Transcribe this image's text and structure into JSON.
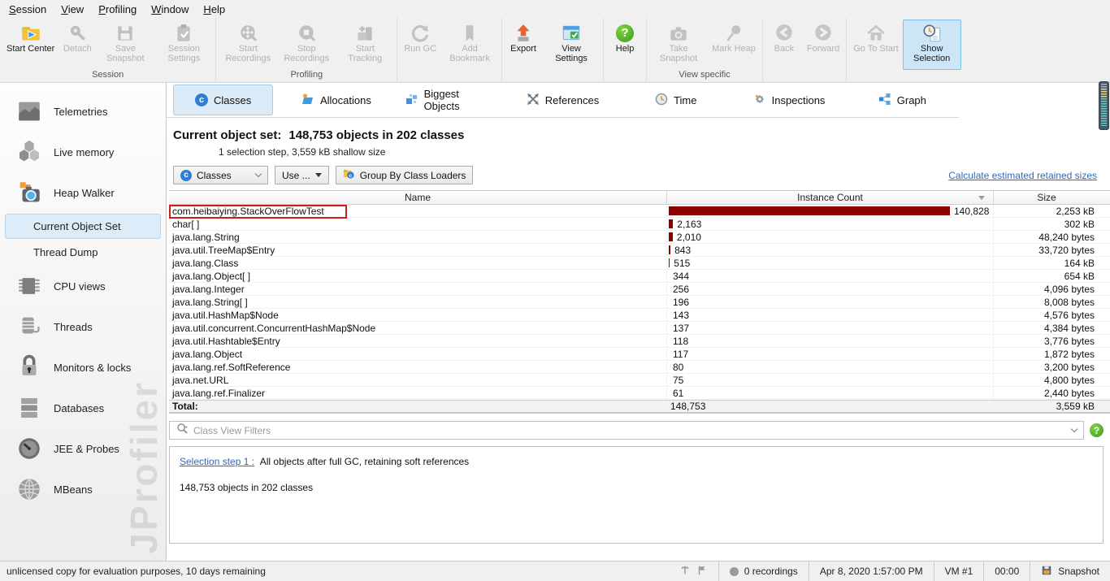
{
  "menu": {
    "items": [
      "Session",
      "View",
      "Profiling",
      "Window",
      "Help"
    ]
  },
  "toolbar": {
    "groups": [
      {
        "label": "Session",
        "buttons": [
          {
            "label": "Start Center"
          },
          {
            "label": "Detach"
          },
          {
            "label": "Save Snapshot"
          },
          {
            "label": "Session Settings"
          }
        ]
      },
      {
        "label": "Profiling",
        "buttons": [
          {
            "label": "Start Recordings"
          },
          {
            "label": "Stop Recordings"
          },
          {
            "label": "Start Tracking"
          }
        ]
      },
      {
        "label": "",
        "buttons": [
          {
            "label": "Run GC"
          },
          {
            "label": "Add Bookmark"
          }
        ]
      },
      {
        "label": "",
        "buttons": [
          {
            "label": "Export"
          },
          {
            "label": "View Settings"
          }
        ]
      },
      {
        "label": "",
        "buttons": [
          {
            "label": "Help"
          }
        ]
      },
      {
        "label": "View specific",
        "buttons": [
          {
            "label": "Take Snapshot"
          },
          {
            "label": "Mark Heap"
          }
        ]
      },
      {
        "label": "",
        "buttons": [
          {
            "label": "Back"
          },
          {
            "label": "Forward"
          }
        ]
      },
      {
        "label": "",
        "buttons": [
          {
            "label": "Go To Start"
          },
          {
            "label": "Show Selection"
          }
        ]
      }
    ]
  },
  "sidebar": {
    "items": [
      {
        "label": "Telemetries"
      },
      {
        "label": "Live memory"
      },
      {
        "label": "Heap Walker"
      },
      {
        "label": "Current Object Set"
      },
      {
        "label": "Thread Dump"
      },
      {
        "label": "CPU views"
      },
      {
        "label": "Threads"
      },
      {
        "label": "Monitors & locks"
      },
      {
        "label": "Databases"
      },
      {
        "label": "JEE & Probes"
      },
      {
        "label": "MBeans"
      }
    ],
    "watermark": "JProfiler"
  },
  "tabs": {
    "items": [
      {
        "label": "Classes"
      },
      {
        "label": "Allocations"
      },
      {
        "label": "Biggest Objects"
      },
      {
        "label": "References"
      },
      {
        "label": "Time"
      },
      {
        "label": "Inspections"
      },
      {
        "label": "Graph"
      }
    ]
  },
  "heap": {
    "title": "Current object set:",
    "title_value": "148,753 objects in 202 classes",
    "subtitle": "1 selection step, 3,559 kB shallow size",
    "classes_dropdown": "Classes",
    "use_button": "Use ...",
    "group_button": "Group By Class Loaders",
    "retained_link": "Calculate estimated retained sizes"
  },
  "table": {
    "columns": [
      "Name",
      "Instance Count",
      "Size"
    ],
    "rows": [
      {
        "name": "com.heibaiying.StackOverFlowTest",
        "count": "140,828",
        "size": "2,253 kB"
      },
      {
        "name": "char[ ]",
        "count": "2,163",
        "size": "302 kB"
      },
      {
        "name": "java.lang.String",
        "count": "2,010",
        "size": "48,240 bytes"
      },
      {
        "name": "java.util.TreeMap$Entry",
        "count": "843",
        "size": "33,720 bytes"
      },
      {
        "name": "java.lang.Class",
        "count": "515",
        "size": "164 kB"
      },
      {
        "name": "java.lang.Object[ ]",
        "count": "344",
        "size": "654 kB"
      },
      {
        "name": "java.lang.Integer",
        "count": "256",
        "size": "4,096 bytes"
      },
      {
        "name": "java.lang.String[ ]",
        "count": "196",
        "size": "8,008 bytes"
      },
      {
        "name": "java.util.HashMap$Node",
        "count": "143",
        "size": "4,576 bytes"
      },
      {
        "name": "java.util.concurrent.ConcurrentHashMap$Node",
        "count": "137",
        "size": "4,384 bytes"
      },
      {
        "name": "java.util.Hashtable$Entry",
        "count": "118",
        "size": "3,776 bytes"
      },
      {
        "name": "java.lang.Object",
        "count": "117",
        "size": "1,872 bytes"
      },
      {
        "name": "java.lang.ref.SoftReference",
        "count": "80",
        "size": "3,200 bytes"
      },
      {
        "name": "java.net.URL",
        "count": "75",
        "size": "4,800 bytes"
      },
      {
        "name": "java.lang.ref.Finalizer",
        "count": "61",
        "size": "2,440 bytes"
      }
    ],
    "total": {
      "name": "Total:",
      "count": "148,753",
      "size": "3,559 kB"
    }
  },
  "filter": {
    "placeholder": "Class View Filters"
  },
  "selection": {
    "link": "Selection step 1 :",
    "text": "All objects after full GC, retaining soft references",
    "summary": "148,753 objects in 202 classes"
  },
  "status": {
    "left": "unlicensed copy for evaluation purposes, 10 days remaining",
    "recordings": "0 recordings",
    "timestamp": "Apr 8, 2020 1:57:00 PM",
    "vm": "VM #1",
    "time": "00:00",
    "snapshot": "Snapshot"
  },
  "colors": {
    "instance_bar": "#8b0000",
    "selection_bg": "#ddecf9",
    "tab_selected_bg": "#dcebf8",
    "link": "#3567b0",
    "annotation_border": "#d01b1b"
  }
}
